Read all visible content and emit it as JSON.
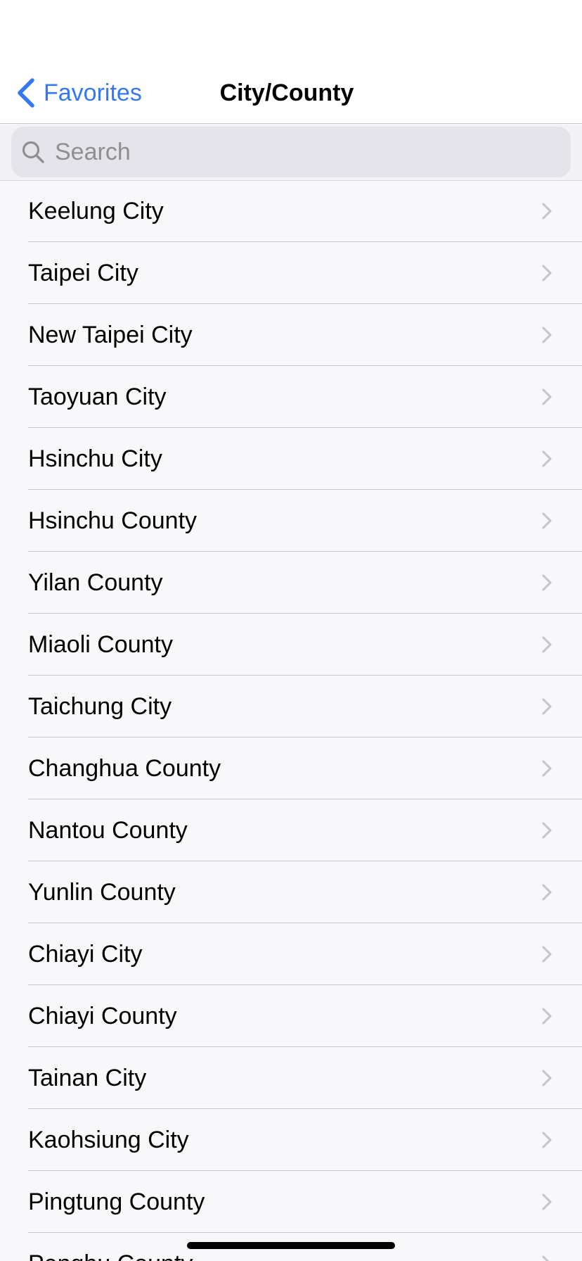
{
  "nav": {
    "back_label": "Favorites",
    "title": "City/County"
  },
  "search": {
    "placeholder": "Search",
    "value": ""
  },
  "list": {
    "items": [
      {
        "label": "Keelung City"
      },
      {
        "label": "Taipei City"
      },
      {
        "label": "New Taipei City"
      },
      {
        "label": "Taoyuan City"
      },
      {
        "label": "Hsinchu City"
      },
      {
        "label": "Hsinchu County"
      },
      {
        "label": "Yilan County"
      },
      {
        "label": "Miaoli County"
      },
      {
        "label": "Taichung City"
      },
      {
        "label": "Changhua County"
      },
      {
        "label": "Nantou County"
      },
      {
        "label": "Yunlin County"
      },
      {
        "label": "Chiayi City"
      },
      {
        "label": "Chiayi County"
      },
      {
        "label": "Tainan City"
      },
      {
        "label": "Kaohsiung City"
      },
      {
        "label": "Pingtung County"
      },
      {
        "label": "Penghu County"
      }
    ]
  },
  "icons": {
    "back": "chevron-left-icon",
    "search": "magnifying-glass-icon",
    "row": "chevron-right-icon"
  },
  "colors": {
    "accent": "#3478f6",
    "background": "#f8f8fb",
    "separator": "#c9c9cd",
    "chevron": "#c4c4c7",
    "search_field": "#e4e4ea",
    "placeholder": "#8e8e93"
  }
}
